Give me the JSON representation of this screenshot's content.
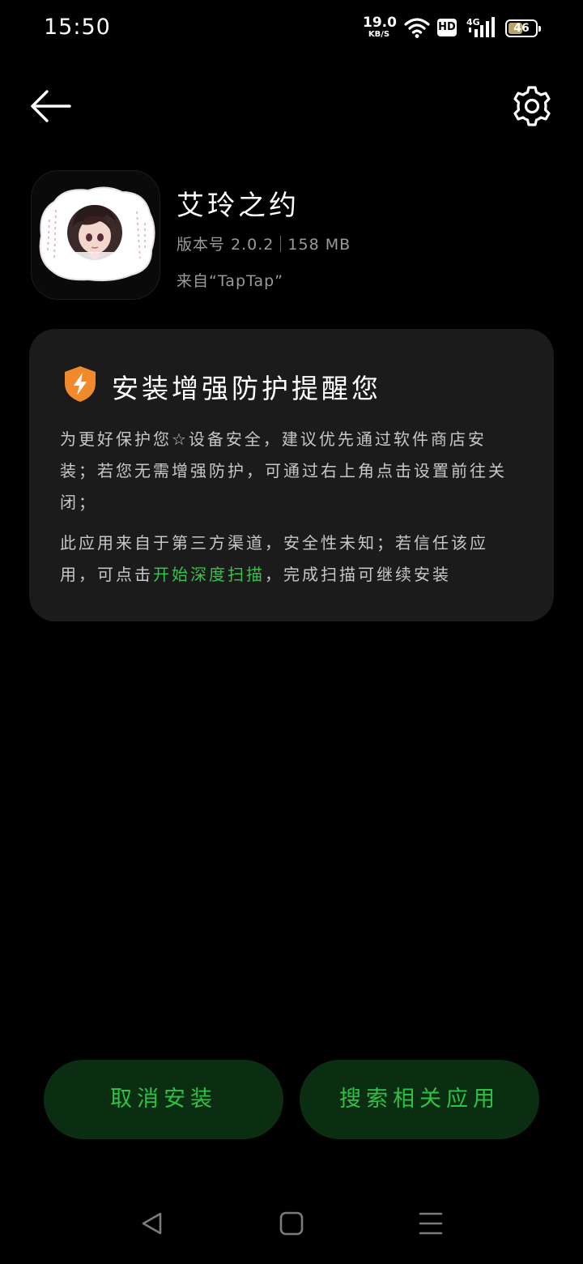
{
  "status_bar": {
    "time": "15:50",
    "net_speed_value": "19.0",
    "net_speed_unit": "KB/S",
    "hd_label": "HD",
    "network_type": "4G",
    "battery_level": "46",
    "icons": [
      "wifi-icon",
      "hd-icon",
      "signal-icon",
      "battery-icon"
    ]
  },
  "nav": {
    "back_icon": "back-arrow-icon",
    "settings_icon": "gear-icon"
  },
  "app": {
    "name": "艾玲之约",
    "version_label": "版本号 2.0.2",
    "size": "158 MB",
    "source": "来自“TapTap”"
  },
  "warning": {
    "title": "安装增强防护提醒您",
    "para1": "为更好保护您☆设备安全，建议优先通过软件商店安装；若您无需增强防护，可通过右上角点击设置前往关闭；",
    "para2_prefix": "此应用来自于第三方渠道，安全性未知；若信任该应用，可点击",
    "para2_link": "开始深度扫描",
    "para2_suffix": "，完成扫描可继续安装",
    "shield_color": "#F08A2C",
    "link_color": "#33C44A"
  },
  "actions": {
    "cancel_label": "取消安装",
    "search_label": "搜索相关应用",
    "button_bg": "#0B2E12",
    "button_text_color": "#2EC146"
  },
  "system_nav": {
    "icons": [
      "nav-back-icon",
      "nav-home-icon",
      "nav-recents-icon"
    ]
  }
}
